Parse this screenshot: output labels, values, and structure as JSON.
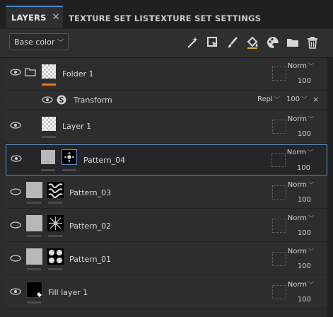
{
  "tabs": [
    {
      "label": "LAYERS",
      "active": true
    },
    {
      "label": "TEXTURE SET LIST",
      "active": false
    },
    {
      "label": "TEXTURE SET SETTINGS",
      "active": false
    }
  ],
  "toolbar": {
    "channel": "Base color",
    "icons": [
      "magic-wand-icon",
      "fill-bucket-icon",
      "paint-brush-icon",
      "paint-bucket-icon",
      "palette-icon",
      "folder-icon",
      "trash-icon"
    ]
  },
  "layers": [
    {
      "name": "Folder 1",
      "blend": "Norm",
      "opacity": "100"
    },
    {
      "name": "Transform",
      "blend": "Repl",
      "opacity": "100",
      "close": "×"
    },
    {
      "name": "Layer 1",
      "blend": "Norm",
      "opacity": "100"
    },
    {
      "name": "Pattern_04",
      "blend": "Norm",
      "opacity": "100"
    },
    {
      "name": "Pattern_03",
      "blend": "Norm",
      "opacity": "100"
    },
    {
      "name": "Pattern_02",
      "blend": "Norm",
      "opacity": "100"
    },
    {
      "name": "Pattern_01",
      "blend": "Norm",
      "opacity": "100"
    },
    {
      "name": "Fill layer 1",
      "blend": "Norm",
      "opacity": "100"
    }
  ],
  "colors": {
    "accent": "#4a86c5",
    "folder_bar": "#e07b1c",
    "selected_border": "#5b8fcf"
  }
}
